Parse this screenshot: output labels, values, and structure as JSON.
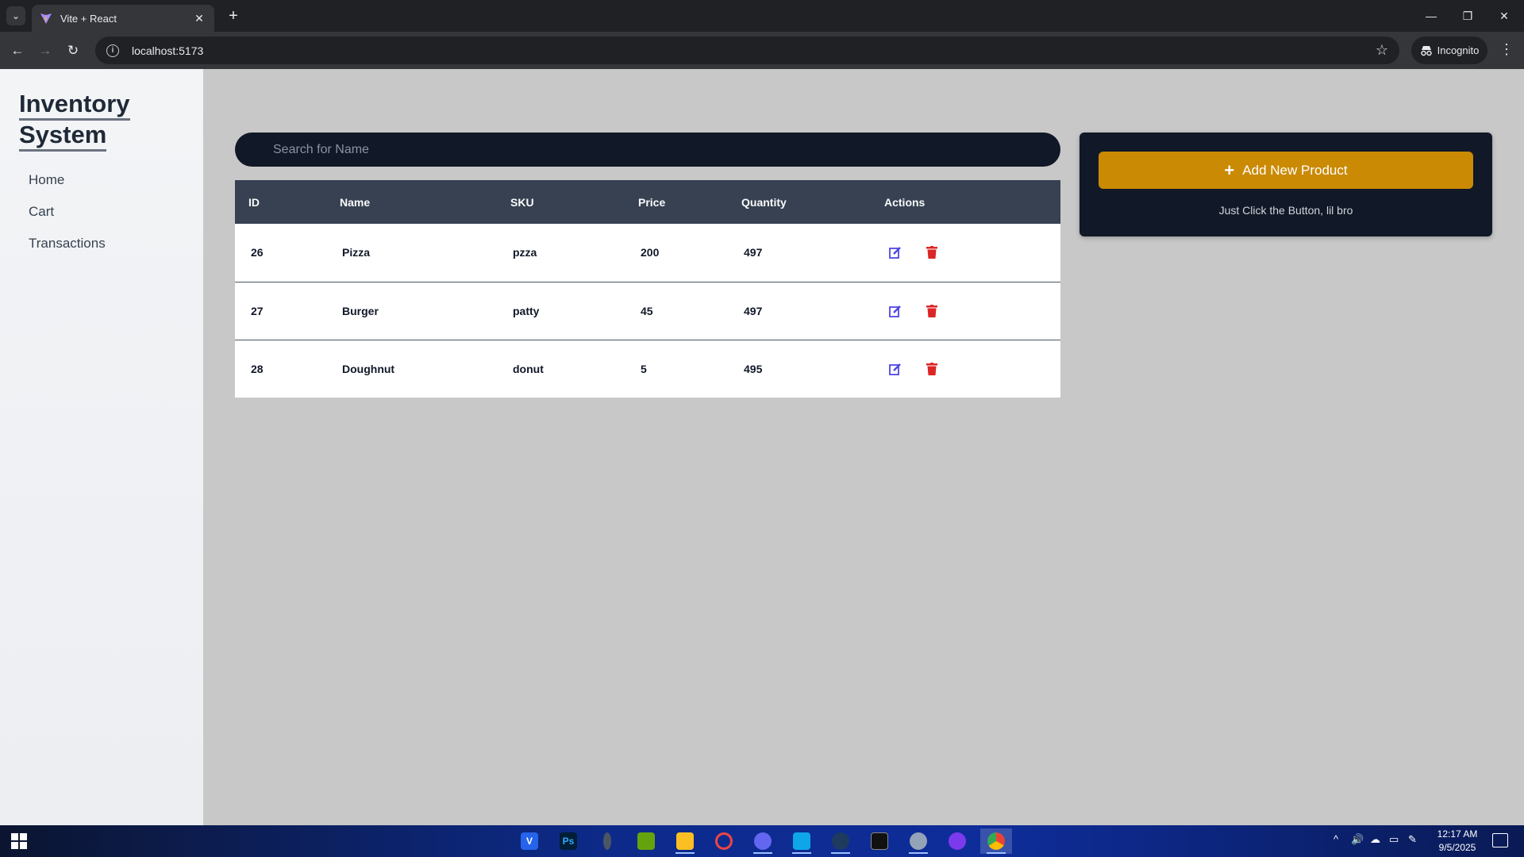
{
  "browser": {
    "tab_title": "Vite + React",
    "url": "localhost:5173",
    "incognito_label": "Incognito"
  },
  "sidebar": {
    "brand_line1": "Inventory",
    "brand_line2": "System",
    "items": [
      {
        "label": "Home"
      },
      {
        "label": "Cart"
      },
      {
        "label": "Transactions"
      }
    ]
  },
  "search": {
    "placeholder": "Search for Name"
  },
  "table": {
    "headers": [
      "ID",
      "Name",
      "SKU",
      "Price",
      "Quantity",
      "Actions"
    ],
    "rows": [
      {
        "id": "26",
        "name": "Pizza",
        "sku": "pzza",
        "price": "200",
        "quantity": "497"
      },
      {
        "id": "27",
        "name": "Burger",
        "sku": "patty",
        "price": "45",
        "quantity": "497"
      },
      {
        "id": "28",
        "name": "Doughnut",
        "sku": "donut",
        "price": "5",
        "quantity": "495"
      }
    ],
    "edit_icon_color": "#4f46e5",
    "delete_icon_color": "#dc2626"
  },
  "panel": {
    "add_button_label": "Add New Product",
    "hint": "Just Click the Button, lil bro",
    "button_color": "#ca8a04"
  },
  "taskbar": {
    "time": "12:17 AM",
    "date": "9/5/2025",
    "apps": [
      "vivaldi-icon",
      "photoshop-icon",
      "app-icon",
      "minecraft-icon",
      "file-explorer-icon",
      "opera-icon",
      "discord-icon",
      "vscode-icon",
      "steam-icon",
      "terminal-icon",
      "paint-icon",
      "github-icon",
      "chrome-icon"
    ]
  }
}
